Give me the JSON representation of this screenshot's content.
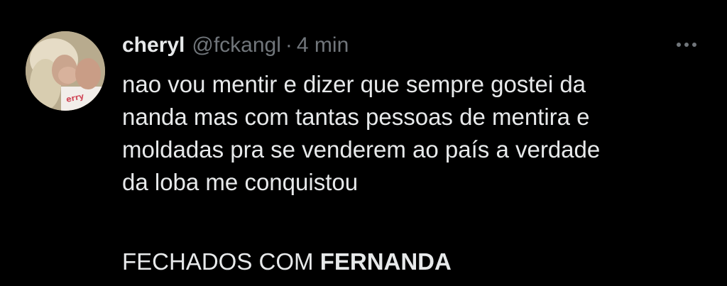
{
  "author": {
    "display_name": "cheryl",
    "handle": "@fckangl",
    "separator": "·",
    "time": "4 min",
    "avatar_icon": "profile-photo-avatar"
  },
  "menu": {
    "icon": "more-horizontal-icon"
  },
  "tweet": {
    "lines": [
      "nao vou mentir e dizer que sempre gostei da",
      "nanda mas com tantas pessoas de mentira e",
      "moldadas pra se venderem ao país a verdade",
      "da loba me conquistou"
    ],
    "closing_prefix": "FECHADOS COM",
    "closing_bold": "FERNANDA"
  },
  "colors": {
    "background": "#000000",
    "primary_text": "#e7e9ea",
    "secondary_text": "#71767b"
  }
}
